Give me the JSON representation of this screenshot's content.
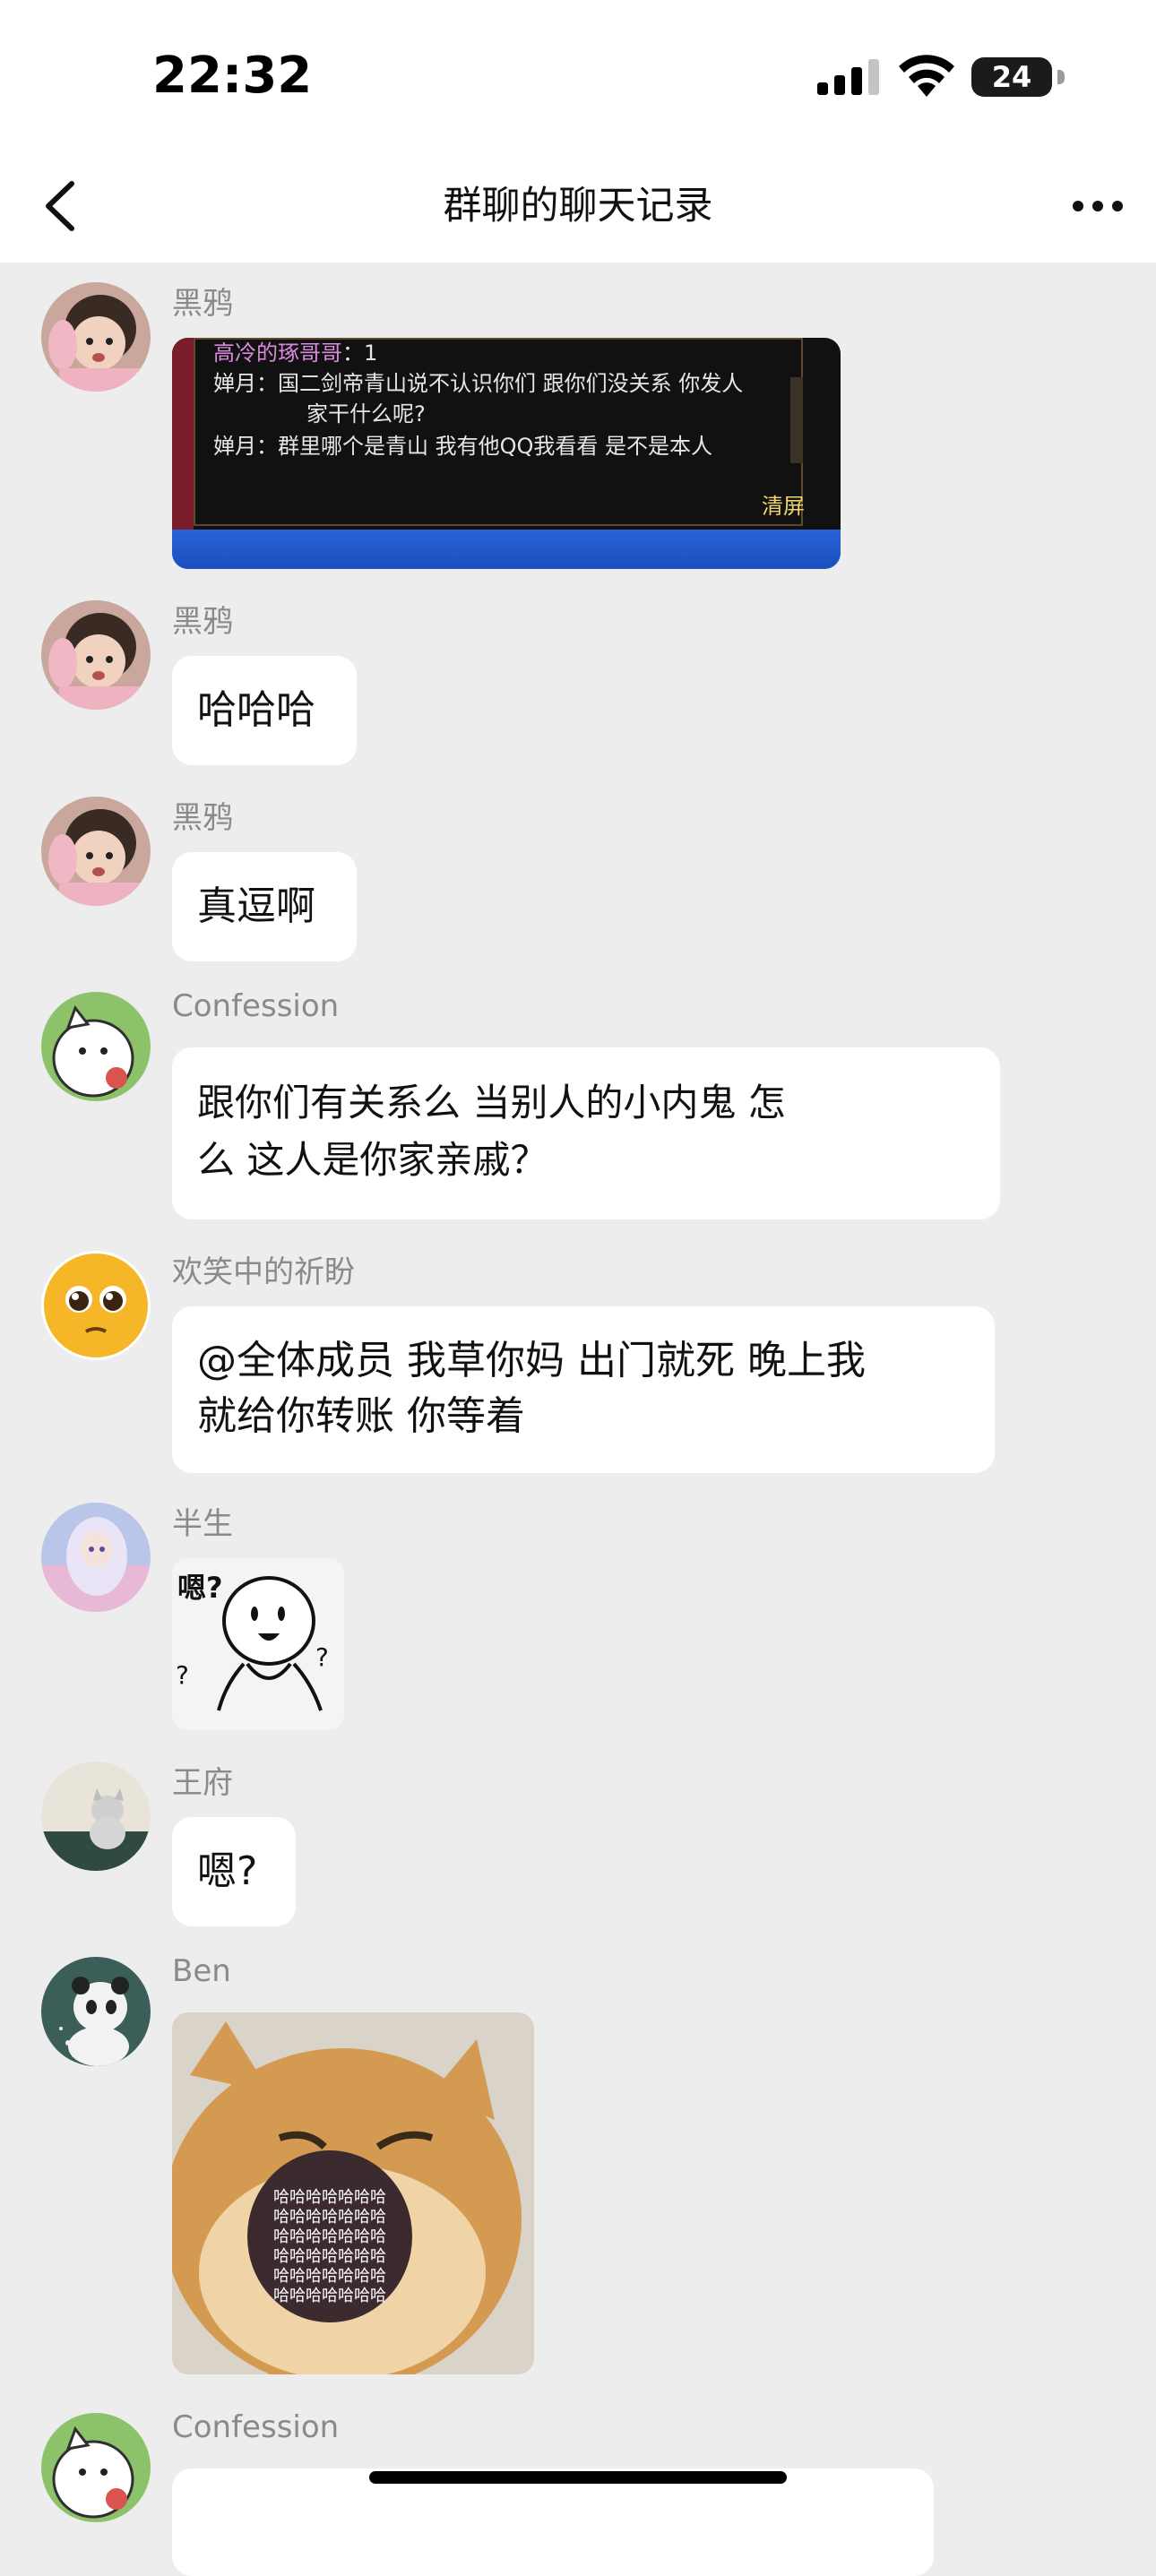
{
  "status_bar": {
    "time": "22:32",
    "battery": "24"
  },
  "nav": {
    "title": "群聊的聊天记录",
    "back_icon": "chevron-left-icon",
    "more_icon": "ellipsis-icon"
  },
  "messages": [
    {
      "sender": "黑鸦",
      "type": "image",
      "image": {
        "line1_name": "高冷的琢哥哥",
        "line1_count": "：1",
        "line2": "婵月：国二剑帝青山说不认识你们 跟你们没关系 你发人",
        "line3": "家干什么呢?",
        "line4": "婵月：群里哪个是青山 我有他QQ我看看 是不是本人",
        "clear_label": "清屏"
      }
    },
    {
      "sender": "黑鸦",
      "type": "text",
      "text": "哈哈哈"
    },
    {
      "sender": "黑鸦",
      "type": "text",
      "text": "真逗啊"
    },
    {
      "sender": "Confession",
      "type": "text",
      "lines": [
        "跟你们有关系么  当别人的小内鬼   怎",
        "么 这人是你家亲戚？"
      ]
    },
    {
      "sender": "欢笑中的祈盼",
      "type": "text",
      "lines": [
        "@全体成员 我草你妈 出门就死 晚上我",
        "就给你转账 你等着"
      ]
    },
    {
      "sender": "半生",
      "type": "sticker",
      "sticker_text": "嗯?"
    },
    {
      "sender": "王府",
      "type": "text",
      "text": "嗯?"
    },
    {
      "sender": "Ben",
      "type": "sticker",
      "sticker_text": "哈哈哈哈哈哈哈"
    },
    {
      "sender": "Confession",
      "type": "text",
      "text": ""
    }
  ],
  "colors": {
    "background": "#ededed",
    "bubble": "#ffffff",
    "sender": "#8a8a8a",
    "title": "#111111"
  }
}
